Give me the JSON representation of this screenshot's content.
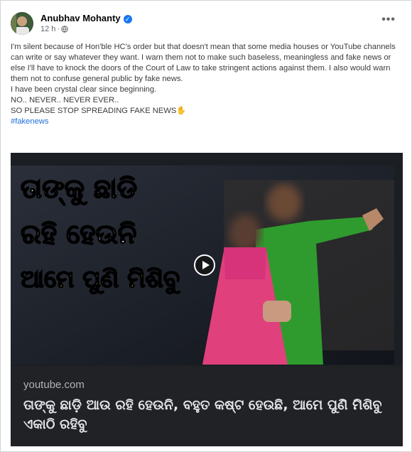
{
  "post": {
    "author": "Anubhav Mohanty",
    "timestamp": "12 h",
    "more_icon": "•••",
    "paragraphs": [
      "I'm silent because of Hon'ble HC's order but that doesn't mean that some media houses or YouTube channels can write or say whatever they want. I warn them not to make such baseless, meaningless and fake news or else I'll have to knock the doors of the Court of Law to take stringent actions against them. I also would warn them not to confuse general public by fake news.",
      "I have been crystal clear since beginning.",
      "NO.. NEVER.. NEVER EVER..",
      "SO PLEASE STOP SPREADING FAKE NEWS✋"
    ],
    "hashtag": "#fakenews"
  },
  "video": {
    "overlay_line1": "ତାଙ୍କୁ ଛାଡି",
    "overlay_line2": "ରହି ହେଉନି",
    "overlay_line3": "ଆମେ ପୁଣି ମିଶିବୁ"
  },
  "link": {
    "domain": "youtube.com",
    "title": "ତାଙ୍କୁ ଛାଡ଼ି ଆଉ ରହି ହେଉନି, ବହୁତ କଷ୍ଟ ହେଉଛି, ଆମେ ପୁଣି ମିଶିବୁ ଏକାଠି ରହିବୁ"
  },
  "colors": {
    "link_blue": "#216fdb",
    "verified_blue": "#1877f2",
    "overlay_white": "#ffffff",
    "overlay_yellow": "#ffe600"
  }
}
